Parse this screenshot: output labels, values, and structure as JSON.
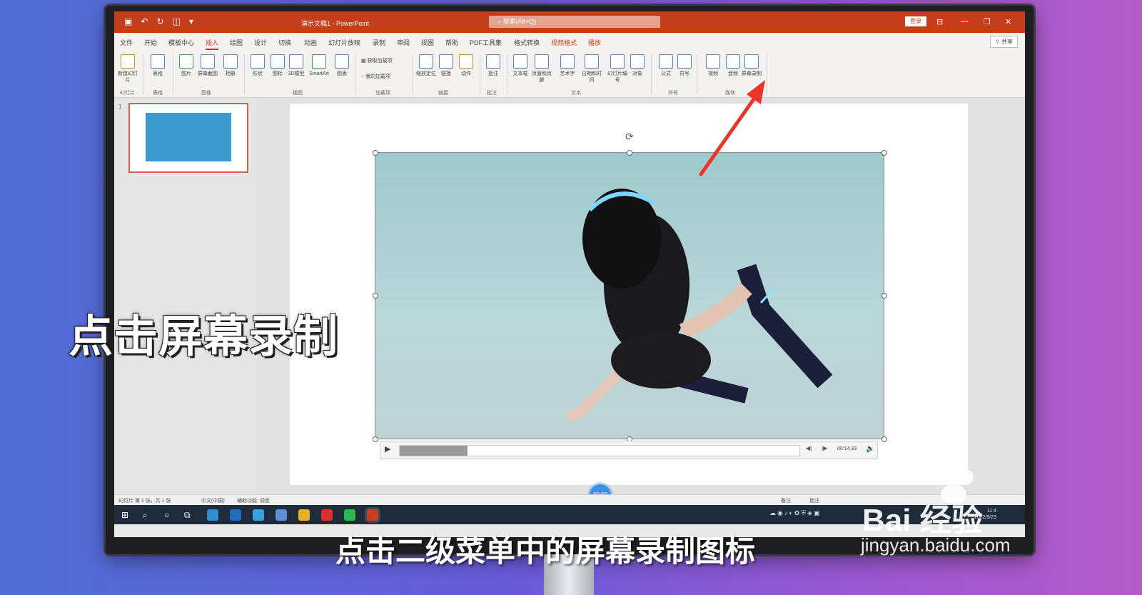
{
  "titlebar": {
    "doc_title": "演示文稿1 - PowerPoint",
    "search_placeholder": "搜索(Alt+Q)",
    "login": "登录"
  },
  "menu": {
    "tabs": [
      "文件",
      "开始",
      "模板中心",
      "插入",
      "绘图",
      "设计",
      "切换",
      "动画",
      "幻灯片放映",
      "录制",
      "审阅",
      "视图",
      "帮助",
      "PDF工具集",
      "格式转换",
      "视频格式",
      "播放"
    ],
    "active": "插入",
    "share": "共享"
  },
  "ribbon": {
    "new_slide": "新建幻灯片",
    "table": "表格",
    "picture": "图片",
    "screenshot": "屏幕截图",
    "album": "相册",
    "shape": "形状",
    "icon": "图标",
    "model3d": "3D模型",
    "smartart": "SmartArt",
    "chart": "图表",
    "get_addins": "获取加载项",
    "my_addins": "我的加载项",
    "zoom": "缩放定位",
    "link": "链接",
    "action": "动作",
    "comment": "批注",
    "textbox": "文本框",
    "header_footer": "页眉和页脚",
    "wordart": "艺术字",
    "datetime": "日期和时间",
    "slide_number": "幻灯片编号",
    "object": "对象",
    "equation": "公式",
    "symbol": "符号",
    "video": "视频",
    "audio": "音频",
    "screen_recording": "屏幕录制",
    "groups": {
      "slides": "幻灯片",
      "tables": "表格",
      "images": "图像",
      "illustrations": "插图",
      "addins": "加载项",
      "links": "链接",
      "comments": "批注",
      "text": "文本",
      "symbols": "符号",
      "media": "媒体"
    }
  },
  "slide_panel": {
    "number": "1"
  },
  "video_player": {
    "timecode": "00:14.33",
    "progress": 0.17
  },
  "record_timer": "00:09",
  "statusbar": {
    "slide_info": "幻灯片 第 1 张，共 1 张",
    "language": "中文(中国)",
    "accessibility": "辅助功能: 调查",
    "notes": "备注",
    "comments": "批注"
  },
  "taskbar": {
    "clock_time": "11:4",
    "clock_date": "2022/9/23"
  },
  "overlay": {
    "caption": "点击屏幕录制",
    "subtitle": "点击二级菜单中的屏幕录制图标"
  },
  "watermark": {
    "brand": "Bai 经验",
    "url": "jingyan.baidu.com"
  },
  "colors": {
    "accent": "#c43e1c",
    "arrow": "#e8352b"
  }
}
